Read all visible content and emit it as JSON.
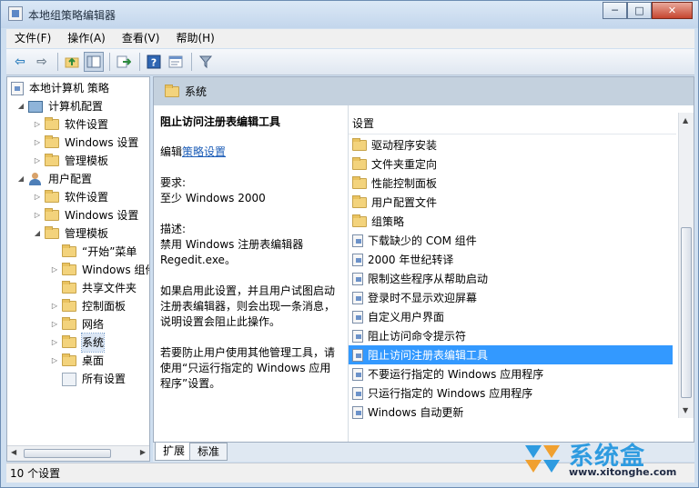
{
  "window": {
    "title": "本地组策略编辑器"
  },
  "caption": {
    "minimize": "─",
    "maximize": "□",
    "close": "✕"
  },
  "menu": [
    "文件(F)",
    "操作(A)",
    "查看(V)",
    "帮助(H)"
  ],
  "toolbar": {
    "icons": [
      "back-arrow-icon",
      "forward-arrow-icon",
      "up-folder-icon",
      "show-hide-tree-icon",
      "export-list-icon",
      "help-icon",
      "properties-icon",
      "filter-icon"
    ]
  },
  "tree": {
    "items": [
      {
        "label": "本地计算机 策略",
        "icon": "policy-icon",
        "depth": 0,
        "expander": ""
      },
      {
        "label": "计算机配置",
        "icon": "computer-icon",
        "depth": 1,
        "expander": "◢"
      },
      {
        "label": "软件设置",
        "icon": "folder-icon",
        "depth": 2,
        "expander": "▷"
      },
      {
        "label": "Windows 设置",
        "icon": "folder-icon",
        "depth": 2,
        "expander": "▷"
      },
      {
        "label": "管理模板",
        "icon": "folder-icon",
        "depth": 2,
        "expander": "▷"
      },
      {
        "label": "用户配置",
        "icon": "user-icon",
        "depth": 1,
        "expander": "◢"
      },
      {
        "label": "软件设置",
        "icon": "folder-icon",
        "depth": 2,
        "expander": "▷"
      },
      {
        "label": "Windows 设置",
        "icon": "folder-icon",
        "depth": 2,
        "expander": "▷"
      },
      {
        "label": "管理模板",
        "icon": "folder-icon",
        "depth": 2,
        "expander": "◢"
      },
      {
        "label": "“开始”菜单",
        "icon": "folder-icon",
        "depth": 3,
        "expander": ""
      },
      {
        "label": "Windows 组件",
        "icon": "folder-icon",
        "depth": 3,
        "expander": "▷"
      },
      {
        "label": "共享文件夹",
        "icon": "folder-icon",
        "depth": 3,
        "expander": ""
      },
      {
        "label": "控制面板",
        "icon": "folder-icon",
        "depth": 3,
        "expander": "▷"
      },
      {
        "label": "网络",
        "icon": "folder-icon",
        "depth": 3,
        "expander": "▷"
      },
      {
        "label": "系统",
        "icon": "folder-icon",
        "depth": 3,
        "expander": "▷",
        "selected": true
      },
      {
        "label": "桌面",
        "icon": "folder-icon",
        "depth": 3,
        "expander": "▷"
      },
      {
        "label": "所有设置",
        "icon": "all-settings-icon",
        "depth": 3,
        "expander": ""
      }
    ]
  },
  "right": {
    "header": "系统",
    "description": {
      "title": "阻止访问注册表编辑工具",
      "edit_prefix": "编辑",
      "edit_link": "策略设置",
      "req_label": "要求:",
      "req_value": "至少 Windows 2000",
      "desc_label": "描述:",
      "desc_line1": "禁用 Windows 注册表编辑器",
      "desc_line2": "Regedit.exe。",
      "para1_line1": "如果启用此设置，并且用户试图启动",
      "para1_line2": "注册表编辑器，则会出现一条消息，",
      "para1_line3": "说明设置会阻止此操作。",
      "para2_line1": "若要防止用户使用其他管理工具，请",
      "para2_line2": "使用“只运行指定的 Windows 应用",
      "para2_line3": "程序”设置。"
    },
    "list_header": "设置",
    "list": [
      {
        "label": "驱动程序安装",
        "type": "folder"
      },
      {
        "label": "文件夹重定向",
        "type": "folder"
      },
      {
        "label": "性能控制面板",
        "type": "folder"
      },
      {
        "label": "用户配置文件",
        "type": "folder"
      },
      {
        "label": "组策略",
        "type": "folder"
      },
      {
        "label": "下载缺少的 COM 组件",
        "type": "policy"
      },
      {
        "label": "2000 年世纪转译",
        "type": "policy"
      },
      {
        "label": "限制这些程序从帮助启动",
        "type": "policy"
      },
      {
        "label": "登录时不显示欢迎屏幕",
        "type": "policy"
      },
      {
        "label": "自定义用户界面",
        "type": "policy"
      },
      {
        "label": "阻止访问命令提示符",
        "type": "policy"
      },
      {
        "label": "阻止访问注册表编辑工具",
        "type": "policy",
        "selected": true
      },
      {
        "label": "不要运行指定的 Windows 应用程序",
        "type": "policy"
      },
      {
        "label": "只运行指定的 Windows 应用程序",
        "type": "policy"
      },
      {
        "label": "Windows 自动更新",
        "type": "policy"
      }
    ]
  },
  "tabs": [
    "扩展",
    "标准"
  ],
  "status": "10 个设置",
  "watermark": {
    "cn": "系统盒",
    "url": "www.xitonghe.com"
  }
}
